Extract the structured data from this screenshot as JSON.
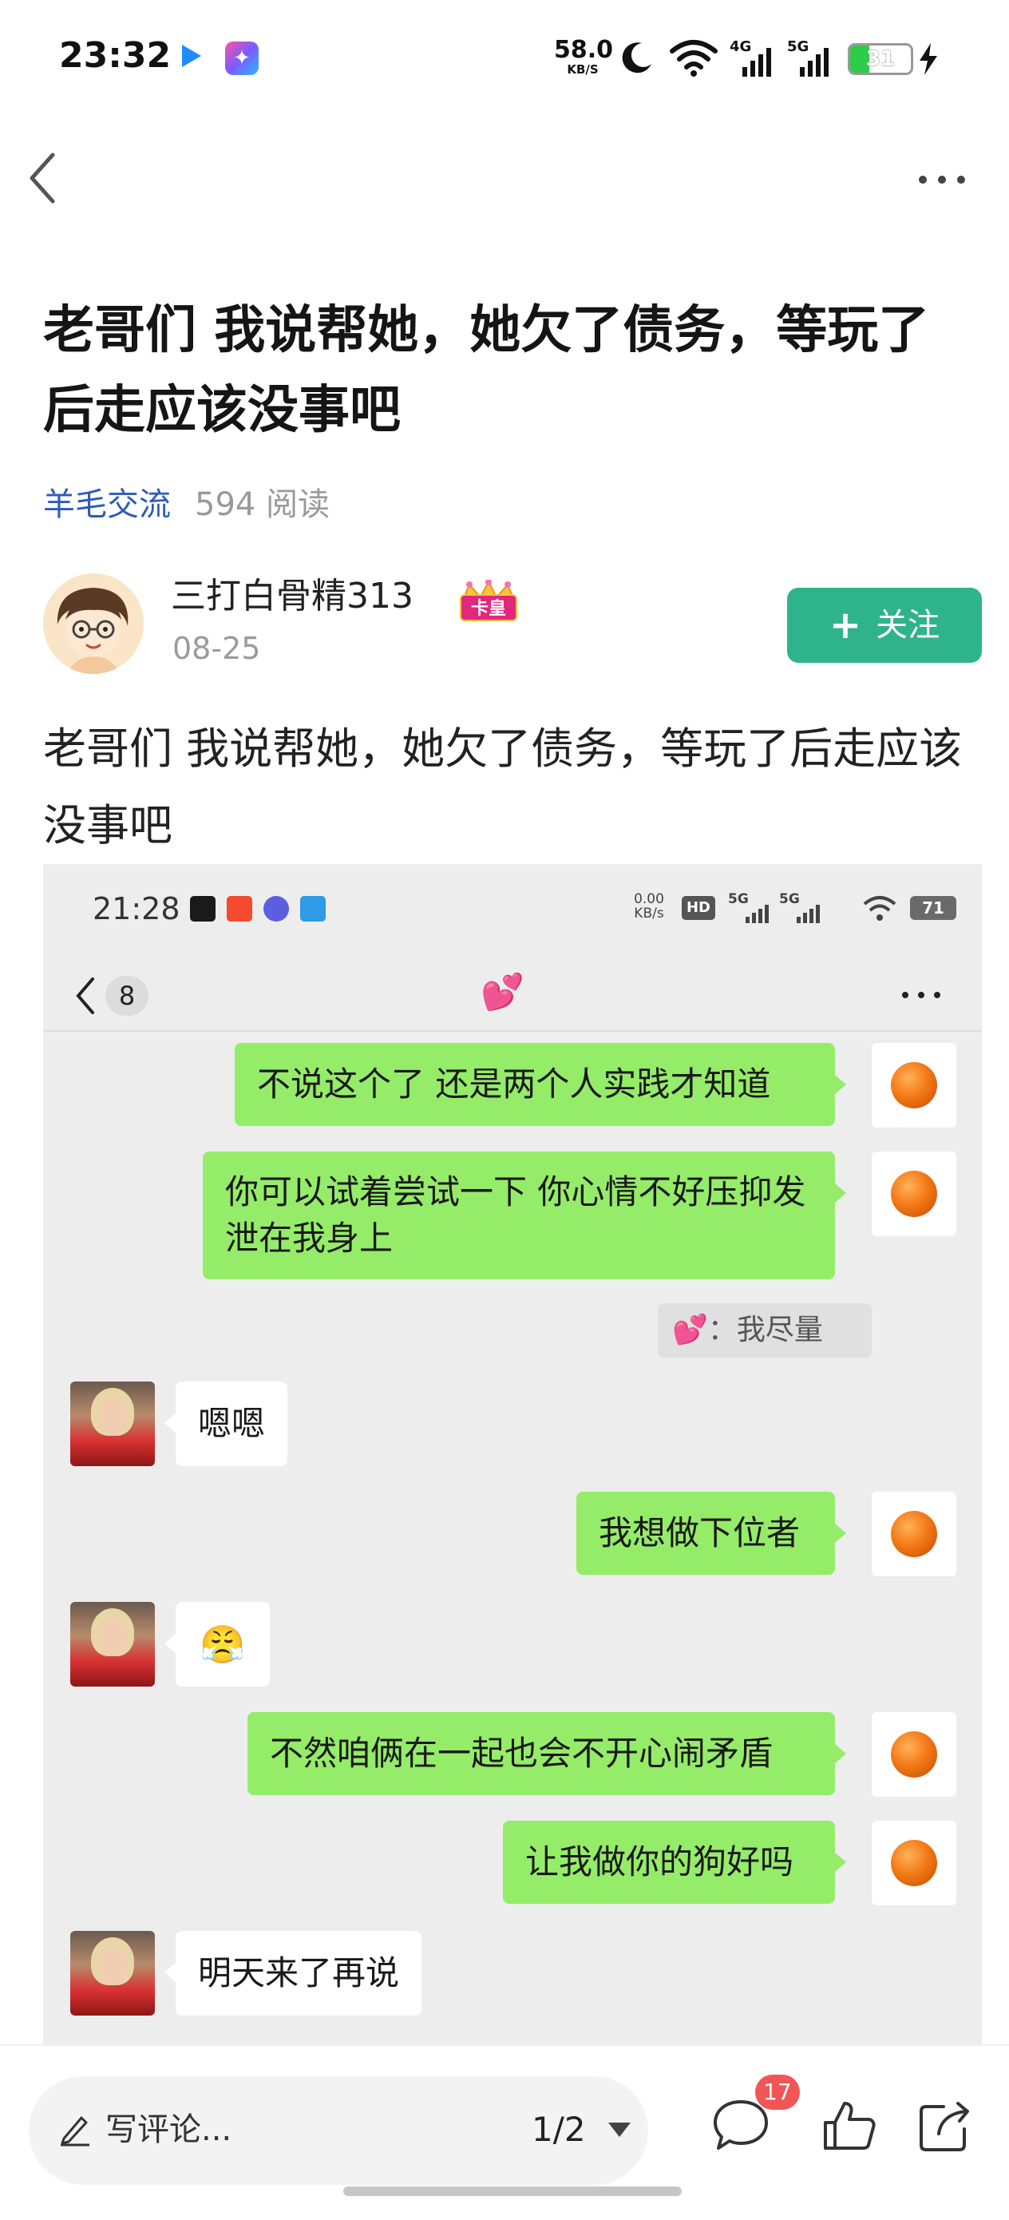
{
  "status_bar": {
    "time": "23:32",
    "speed_value": "58.0",
    "speed_unit": "KB/S",
    "net_1": "4G",
    "net_2": "5G",
    "battery": "31"
  },
  "article": {
    "title": "老哥们 我说帮她，她欠了债务，等玩了后走应该没事吧",
    "channel": "羊毛交流",
    "reads": "594 阅读",
    "author": "三打白骨精313",
    "author_badge": "卡皇",
    "date": "08-25",
    "follow_label": "关注",
    "body": "老哥们 我说帮她，她欠了债务，等玩了后走应该没事吧"
  },
  "chat_screenshot": {
    "status": {
      "time": "21:28",
      "speed_value": "0.00",
      "speed_unit": "KB/s",
      "hd": "HD",
      "net_1": "5G",
      "net_2": "5G",
      "battery": "71"
    },
    "header": {
      "unread_count": "8",
      "contact_name": "💕"
    },
    "messages": [
      {
        "from": "me",
        "text": "不说这个了 还是两个人实践才知道"
      },
      {
        "from": "me",
        "text": "你可以试着尝试一下 你心情不好压抑发泄在我身上"
      },
      {
        "from": "quote",
        "text": "💕：我尽量"
      },
      {
        "from": "other",
        "text": "嗯嗯"
      },
      {
        "from": "me",
        "text": "我想做下位者"
      },
      {
        "from": "other",
        "text": "😤"
      },
      {
        "from": "me",
        "text": "不然咱俩在一起也会不开心闹矛盾"
      },
      {
        "from": "me",
        "text": "让我做你的狗好吗"
      },
      {
        "from": "other",
        "text": "明天来了再说"
      }
    ]
  },
  "bottom_bar": {
    "comment_placeholder": "写评论...",
    "page_indicator": "1/2",
    "comment_count": "17"
  }
}
